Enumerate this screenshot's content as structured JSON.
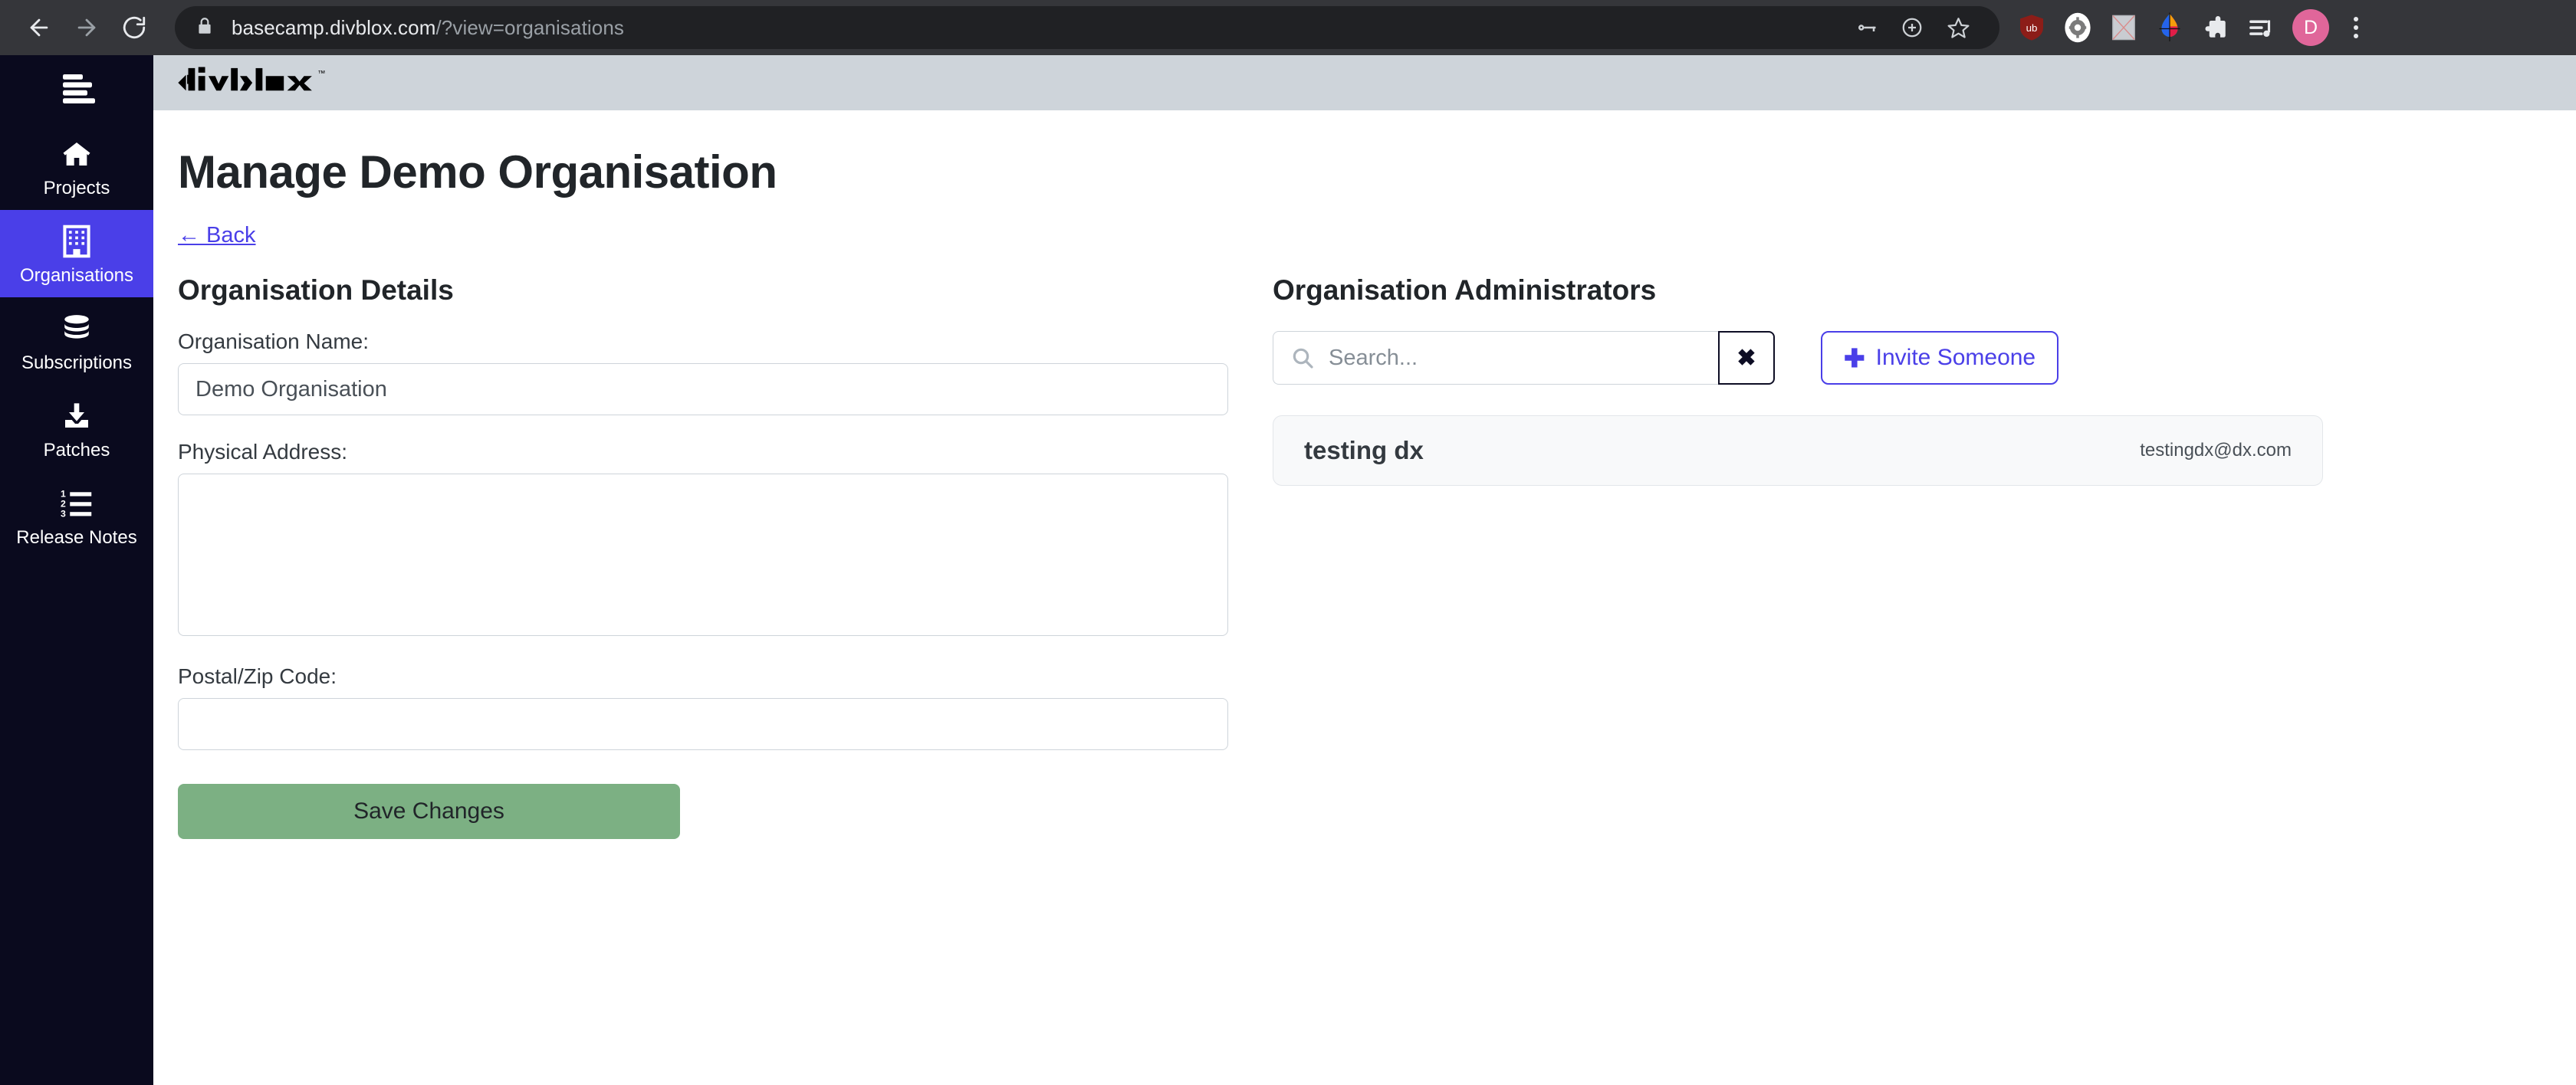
{
  "browser": {
    "url_host": "basecamp.divblox.com",
    "url_path": "/?view=organisations",
    "back_icon": "back-arrow-icon",
    "forward_icon": "forward-arrow-icon",
    "reload_icon": "reload-icon",
    "lock_icon": "lock-icon",
    "omnibox_actions": [
      {
        "name": "password-key-icon"
      },
      {
        "name": "install-app-icon"
      },
      {
        "name": "bookmark-star-icon"
      }
    ],
    "extensions": [
      {
        "name": "ublock-origin-icon",
        "label": "ub",
        "color": "#8c1d18"
      },
      {
        "name": "settings-gear-extension-icon",
        "color": "#ffffff"
      },
      {
        "name": "blocked-image-extension-icon",
        "color": "#c9ccd1"
      },
      {
        "name": "color-picker-extension-icon",
        "color": "#22c55e"
      },
      {
        "name": "extensions-puzzle-icon",
        "color": "#e8eaed"
      },
      {
        "name": "playlist-music-icon",
        "color": "#e8eaed"
      }
    ],
    "profile_initial": "D",
    "profile_color": "#e0669a",
    "menu_icon": "three-dot-menu-icon"
  },
  "sidebar": {
    "toggle": {
      "name": "hamburger-menu-icon"
    },
    "active_color": "#4a3fe8",
    "background": "#0a0a1e",
    "items": [
      {
        "label": "Projects",
        "icon": "home-icon",
        "active": false
      },
      {
        "label": "Organisations",
        "icon": "building-icon",
        "active": true
      },
      {
        "label": "Subscriptions",
        "icon": "database-icon",
        "active": false
      },
      {
        "label": "Patches",
        "icon": "download-icon",
        "active": false
      },
      {
        "label": "Release Notes",
        "icon": "numbered-list-icon",
        "active": false
      }
    ]
  },
  "app_header": {
    "logo_text": "divblox",
    "logo_tm": "™",
    "background": "#ced4da"
  },
  "page": {
    "title": "Manage Demo Organisation",
    "back_label": "← Back",
    "back_color": "#4a3fe8"
  },
  "details": {
    "heading": "Organisation Details",
    "fields": [
      {
        "label": "Organisation Name:",
        "value": "Demo Organisation",
        "placeholder": "",
        "type": "input"
      },
      {
        "label": "Physical Address:",
        "value": "",
        "placeholder": "",
        "type": "textarea"
      },
      {
        "label": "Postal/Zip Code:",
        "value": "",
        "placeholder": "",
        "type": "input"
      }
    ],
    "save_label": "Save Changes",
    "save_color": "#7cb083"
  },
  "administrators": {
    "heading": "Organisation Administrators",
    "search_placeholder": "Search...",
    "search_value": "",
    "search_icon": "search-icon",
    "clear_label": "✖",
    "invite_label": "Invite Someone",
    "invite_plus": "✚",
    "invite_color": "#4a3fe8",
    "list": [
      {
        "name": "testing dx",
        "email": "testingdx@dx.com"
      }
    ]
  }
}
